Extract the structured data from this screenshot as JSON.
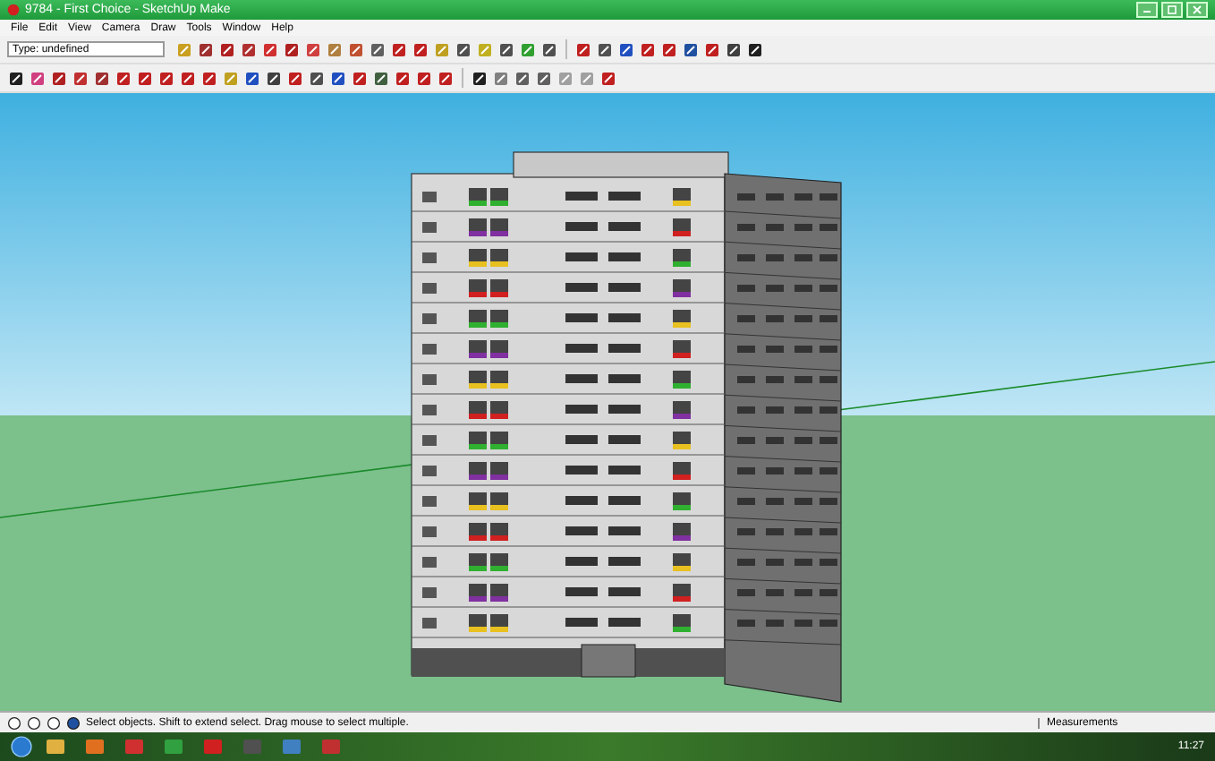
{
  "window": {
    "title": "9784 - First Choice - SketchUp Make"
  },
  "menu": [
    "File",
    "Edit",
    "View",
    "Camera",
    "Draw",
    "Tools",
    "Window",
    "Help"
  ],
  "layer_field": {
    "value": "Type: undefined"
  },
  "status_bar": {
    "message": "Select objects. Shift to extend select. Drag mouse to select multiple.",
    "measurements_label": "Measurements"
  },
  "taskbar": {
    "clock": "11:27"
  }
}
